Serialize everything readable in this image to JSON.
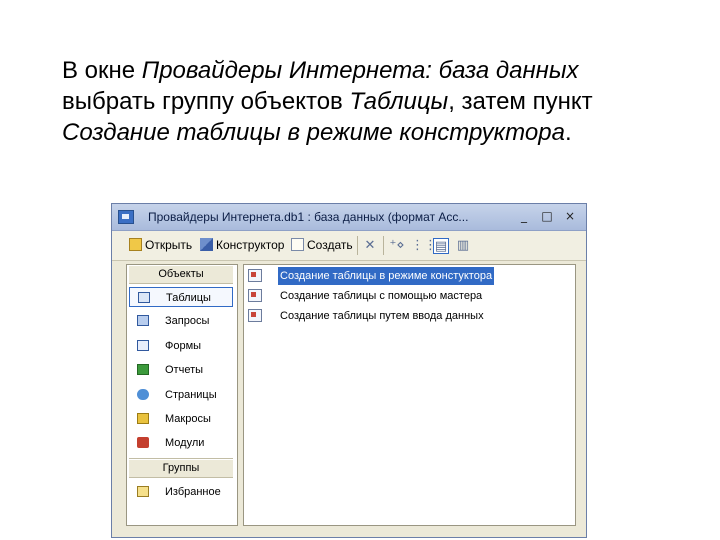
{
  "instruction": {
    "p1": "В окне ",
    "p2": "Провайдеры Интернета: база данных",
    "p3": " выбрать группу объектов ",
    "p4": "Таблицы",
    "p5": ", затем пункт ",
    "p6": "Создание таблицы в режиме конструктора",
    "p7": "."
  },
  "window": {
    "title": "Провайдеры Интернета.db1 : база данных (формат Acc...",
    "min_glyph": "_",
    "max_glyph": "□",
    "close_glyph": "×"
  },
  "toolbar": {
    "open_label": "Открыть",
    "design_label": "Конструктор",
    "create_label": "Создать",
    "delete_glyph": "✕",
    "view_large_glyph": "⁺⋄",
    "view_small_glyph": "⋮⋮",
    "view_list_glyph": "▤",
    "view_details_glyph": "▥"
  },
  "sidebar": {
    "objects_header": "Объекты",
    "groups_header": "Группы",
    "items": [
      {
        "label": "Таблицы",
        "icon": "table-icon",
        "selected": true
      },
      {
        "label": "Запросы",
        "icon": "query-icon"
      },
      {
        "label": "Формы",
        "icon": "form-icon"
      },
      {
        "label": "Отчеты",
        "icon": "report-icon"
      },
      {
        "label": "Страницы",
        "icon": "page-icon"
      },
      {
        "label": "Макросы",
        "icon": "macro-icon"
      },
      {
        "label": "Модули",
        "icon": "module-icon"
      }
    ],
    "group_items": [
      {
        "label": "Избранное",
        "icon": "favorites-icon"
      }
    ]
  },
  "main": {
    "items": [
      {
        "label": "Создание таблицы в режиме констуктора",
        "icon": "design-table-icon",
        "selected": true
      },
      {
        "label": "Создание таблицы с помощью мастера",
        "icon": "wizard-table-icon"
      },
      {
        "label": "Создание таблицы путем ввода данных",
        "icon": "datasheet-table-icon"
      }
    ]
  },
  "colors": {
    "selection": "#316ac5",
    "window_bg": "#ece9d8",
    "titlebar": "#a9bbdc"
  }
}
